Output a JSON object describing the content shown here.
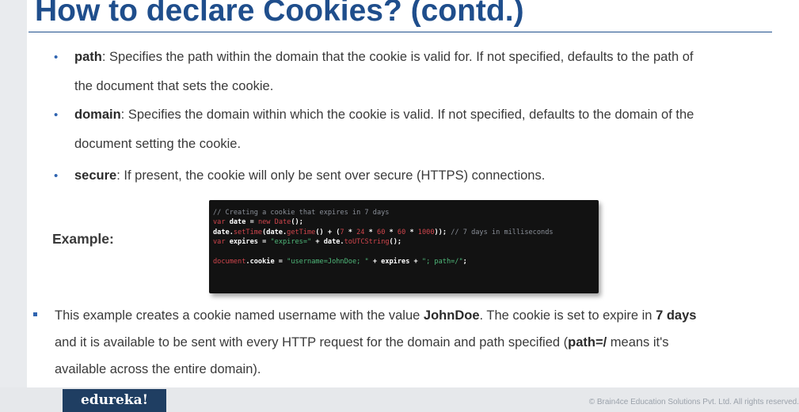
{
  "title": "How to declare Cookies? (contd.)",
  "bullets": [
    {
      "term": "path",
      "line1": ": Specifies the path within the domain that the cookie is valid for. If not specified, defaults to the path of",
      "line2": "the document that sets the cookie."
    },
    {
      "term": "domain",
      "line1": ": Specifies the domain within which the cookie is valid. If not specified, defaults to the domain of the",
      "line2": "document setting the cookie."
    },
    {
      "term": "secure",
      "line1": ": If present, the cookie will only be sent over secure (HTTPS) connections.",
      "line2": ""
    }
  ],
  "example_label": "Example:",
  "code": {
    "comment1": "// Creating a cookie that expires in 7 days",
    "l2_var": "var",
    "l2_date": " date ",
    "l2_eq": "= ",
    "l2_new": "new",
    "l2_Date": " Date",
    "l2_end": "();",
    "l3_date": "date.",
    "l3_setTime": "setTime",
    "l3_open": "(date.",
    "l3_getTime": "getTime",
    "l3_mid": "() + (",
    "l3_n7": "7",
    "l3_x1": " * ",
    "l3_n24": "24",
    "l3_x2": " * ",
    "l3_n60a": "60",
    "l3_x3": " * ",
    "l3_n60b": "60",
    "l3_x4": " * ",
    "l3_n1000": "1000",
    "l3_close": ")); ",
    "l3_comment": "// 7 days in milliseconds",
    "l4_var": "var",
    "l4_expires": " expires ",
    "l4_eq": "= ",
    "l4_str": "\"expires=\"",
    "l4_plus": " + date.",
    "l4_fn": "toUTCString",
    "l4_end": "();",
    "l6_doc": "document",
    "l6_cookie": ".cookie = ",
    "l6_str1": "\"username=JohnDoe; \"",
    "l6_plus1": " + expires + ",
    "l6_str2": "\"; path=/\"",
    "l6_end": ";"
  },
  "note": {
    "l1_a": "This example creates a cookie named username with the value ",
    "l1_b": "JohnDoe",
    "l1_c": ". The cookie is set to expire in ",
    "l1_d": "7 days",
    "l2_a": "and it is available to be sent with every HTTP request for the domain and path specified (",
    "l2_b": "path=/",
    "l2_c": " means it's",
    "l3": "available across the entire domain)."
  },
  "footer": {
    "logo": "edureka!",
    "copyright": "© Brain4ce Education Solutions Pvt. Ltd. All rights reserved."
  },
  "colors": {
    "title": "#1f4e8c",
    "bullet": "#2f64b0",
    "logo_bg": "#1f3e62",
    "code_bg": "#121212"
  }
}
